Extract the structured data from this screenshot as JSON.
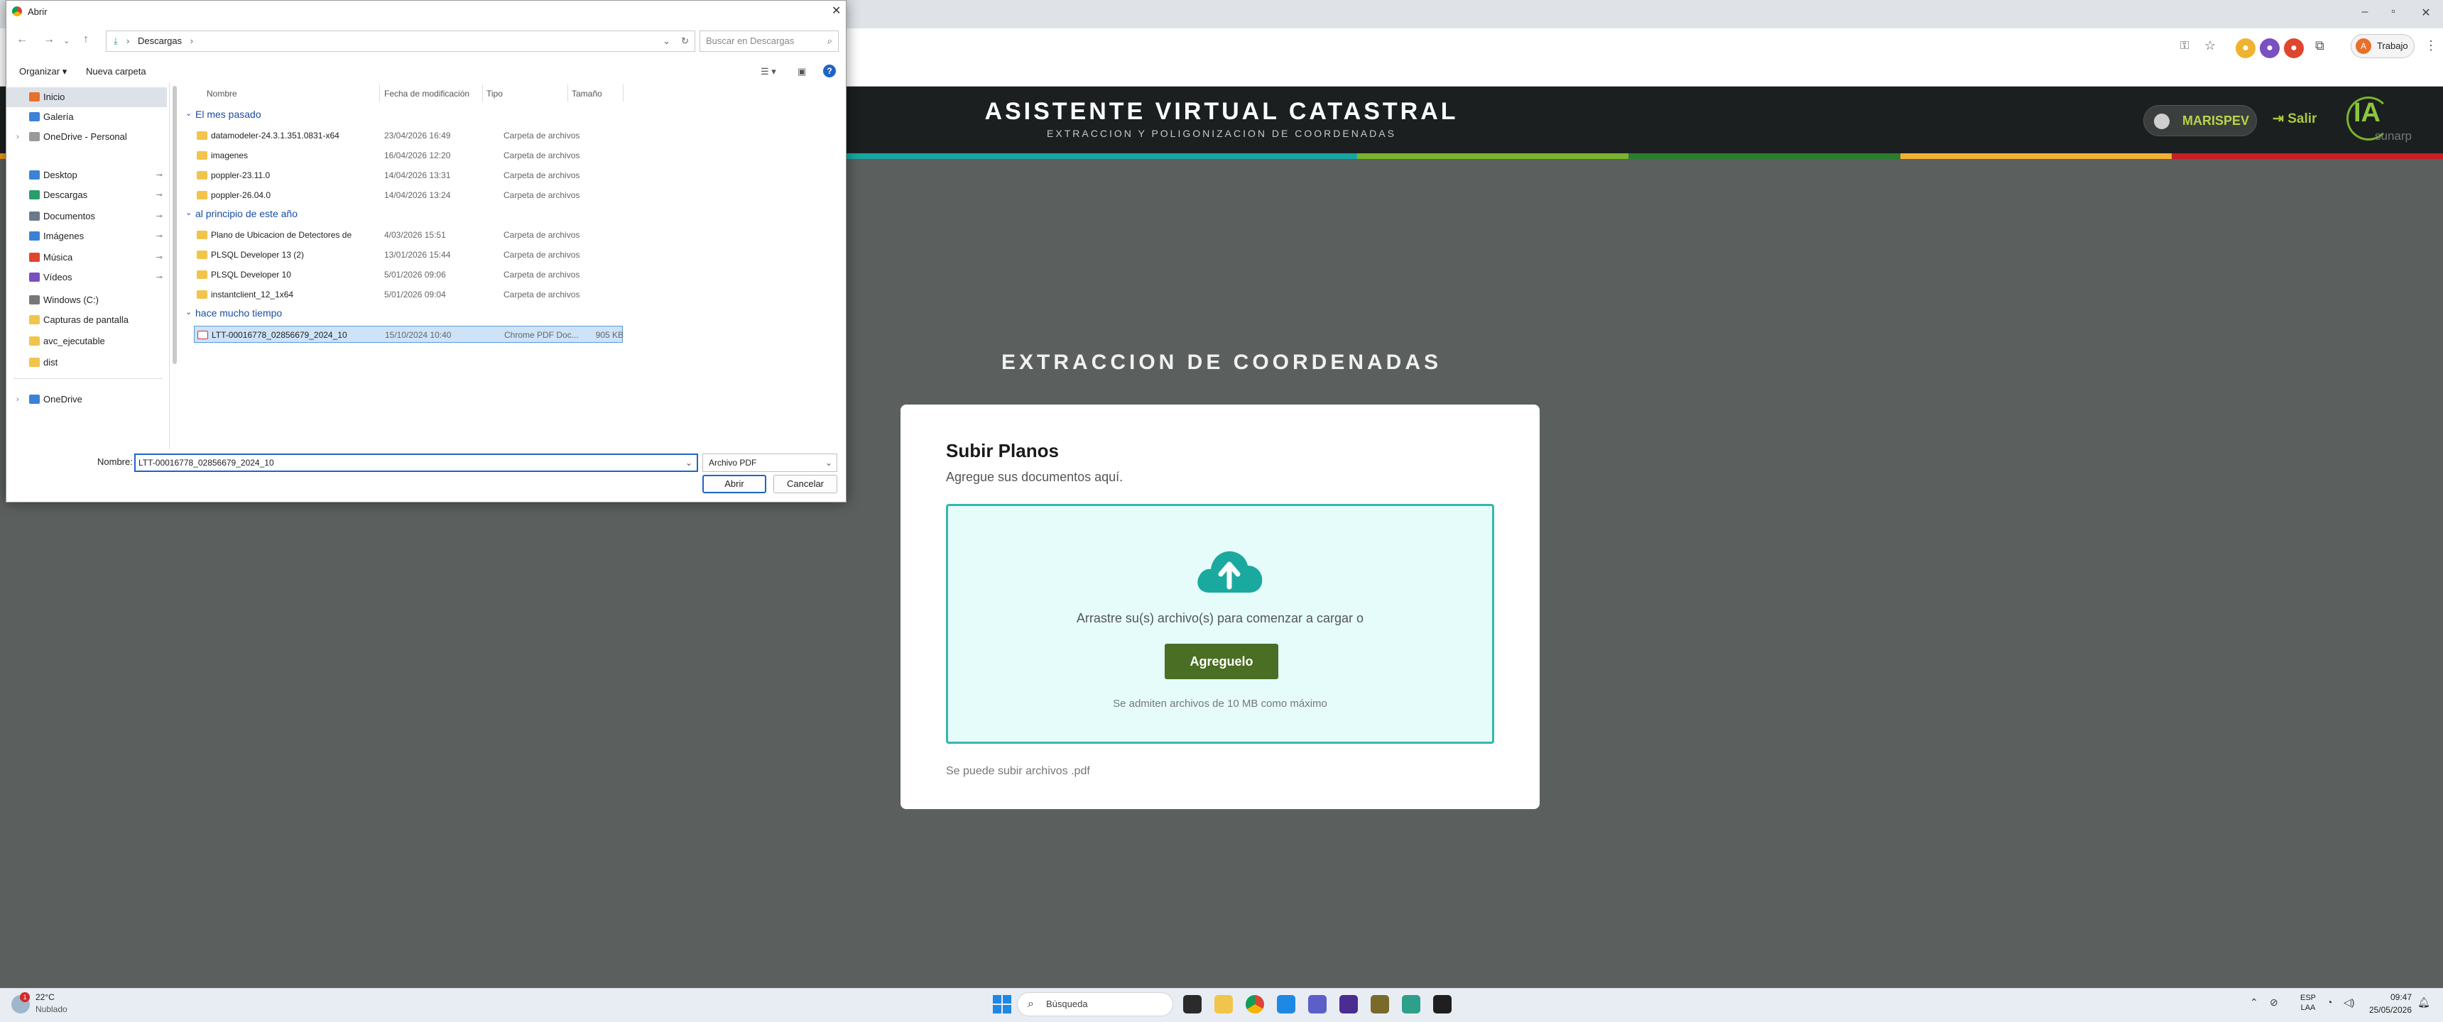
{
  "browser": {
    "profile_label": "Trabajo",
    "profile_initial": "A"
  },
  "app": {
    "title": "ASISTENTE VIRTUAL CATASTRAL",
    "subtitle": "EXTRACCION Y POLIGONIZACION DE COORDENADAS",
    "user": "MARISPEV",
    "logout_label": "Salir",
    "logo_text": "IA",
    "logo_sub": "sunarp",
    "stripe_colors": [
      "#e89a1c",
      "#c91f26",
      "#c91f26",
      "#18a6a3",
      "#18a6a3",
      "#7ab42c",
      "#2a7d2e",
      "#f2b134",
      "#c91f26"
    ]
  },
  "main": {
    "section_title": "EXTRACCION DE COORDENADAS",
    "card_title": "Subir Planos",
    "card_subtitle": "Agregue sus documentos aquí.",
    "drop_text": "Arrastre su(s) archivo(s) para comenzar a cargar o",
    "add_button": "Agreguelo",
    "size_hint": "Se admiten archivos de 10 MB como máximo",
    "footer_note": "Se puede subir archivos .pdf"
  },
  "dialog": {
    "title": "Abrir",
    "path": "Descargas",
    "search_placeholder": "Buscar en Descargas",
    "organize_label": "Organizar",
    "new_folder_label": "Nueva carpeta",
    "columns": {
      "name": "Nombre",
      "date": "Fecha de modificación",
      "type": "Tipo",
      "size": "Tamaño"
    },
    "nav_items": [
      {
        "label": "Inicio",
        "color": "#e8702a"
      },
      {
        "label": "Galería",
        "color": "#3b82d6"
      },
      {
        "label": "OneDrive - Personal",
        "color": "#999"
      },
      {
        "label": "Desktop",
        "color": "#3b82d6"
      },
      {
        "label": "Descargas",
        "color": "#2a9d6a"
      },
      {
        "label": "Documentos",
        "color": "#6b7a8a"
      },
      {
        "label": "Imágenes",
        "color": "#3b82d6"
      },
      {
        "label": "Música",
        "color": "#e0452e"
      },
      {
        "label": "Vídeos",
        "color": "#7a4fc2"
      },
      {
        "label": "Windows (C:)",
        "color": "#777"
      },
      {
        "label": "Capturas de pantalla",
        "color": "#f1c44b"
      },
      {
        "label": "avc_ejecutable",
        "color": "#f1c44b"
      },
      {
        "label": "dist",
        "color": "#f1c44b"
      },
      {
        "label": "OneDrive",
        "color": "#3b82d6"
      }
    ],
    "groups": [
      {
        "label": "El mes pasado",
        "rows": [
          {
            "name": "datamodeler-24.3.1.351.0831-x64",
            "date": "23/04/2026 16:49",
            "type": "Carpeta de archivos",
            "size": ""
          },
          {
            "name": "imagenes",
            "date": "16/04/2026 12:20",
            "type": "Carpeta de archivos",
            "size": ""
          },
          {
            "name": "poppler-23.11.0",
            "date": "14/04/2026 13:31",
            "type": "Carpeta de archivos",
            "size": ""
          },
          {
            "name": "poppler-26.04.0",
            "date": "14/04/2026 13:24",
            "type": "Carpeta de archivos",
            "size": ""
          }
        ]
      },
      {
        "label": "al principio de este año",
        "rows": [
          {
            "name": "Plano de Ubicacion de Detectores de Hu...",
            "date": "4/03/2026 15:51",
            "type": "Carpeta de archivos",
            "size": ""
          },
          {
            "name": "PLSQL Developer 13 (2)",
            "date": "13/01/2026 15:44",
            "type": "Carpeta de archivos",
            "size": ""
          },
          {
            "name": "PLSQL Developer 10",
            "date": "5/01/2026 09:06",
            "type": "Carpeta de archivos",
            "size": ""
          },
          {
            "name": "instantclient_12_1x64",
            "date": "5/01/2026 09:04",
            "type": "Carpeta de archivos",
            "size": ""
          }
        ]
      },
      {
        "label": "hace mucho tiempo",
        "rows": [
          {
            "name": "LTT-00016778_02856679_2024_10",
            "date": "15/10/2024 10:40",
            "type": "Chrome PDF Doc...",
            "size": "905 KB"
          }
        ]
      }
    ],
    "name_label": "Nombre:",
    "filename": "LTT-00016778_02856679_2024_10",
    "file_type": "Archivo PDF",
    "open_button": "Abrir",
    "cancel_button": "Cancelar"
  },
  "taskbar": {
    "temperature": "22°C",
    "weather": "Nublado",
    "search_placeholder": "Búsqueda",
    "lang_1": "ESP",
    "lang_2": "LAA",
    "time": "09:47",
    "date": "25/05/2026"
  }
}
